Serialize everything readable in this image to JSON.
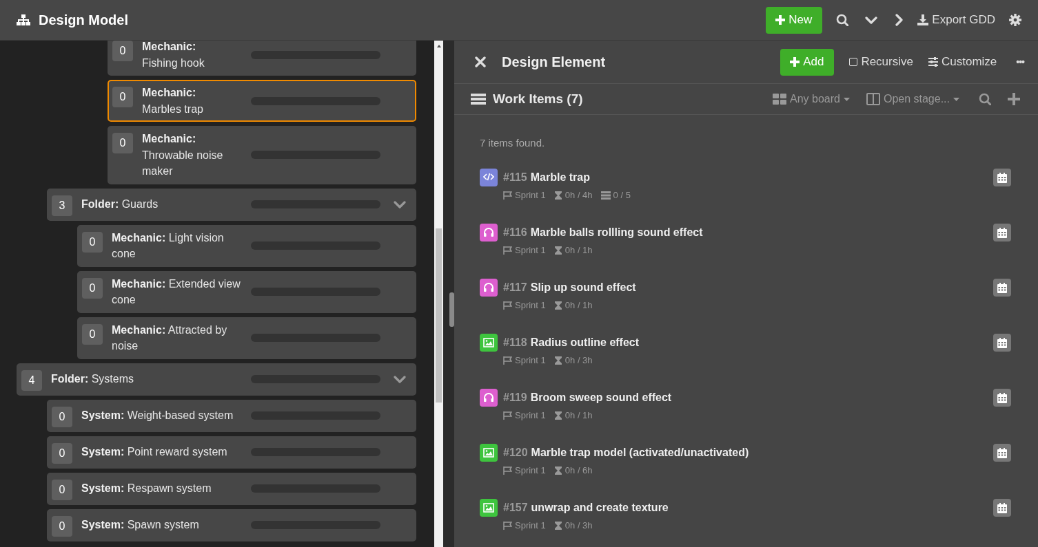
{
  "header": {
    "title": "Design Model",
    "new_button": "New",
    "export_button": "Export GDD"
  },
  "tree": [
    {
      "children": [
        {
          "children": [
            {
              "children": [
                {
                  "kind": "element",
                  "count": "0",
                  "label": "**Mechanic:**\nFishing hook",
                  "selected": false,
                  "level": 0
                },
                {
                  "kind": "element",
                  "count": "0",
                  "label": "**Mechanic:**\nMarbles trap",
                  "selected": true,
                  "level": 0
                },
                {
                  "kind": "element",
                  "count": "0",
                  "label": "**Mechanic:**\nThrowable noise maker",
                  "selected": false,
                  "level": 0
                }
              ]
            }
          ]
        },
        {
          "kind": "folder",
          "count": "3",
          "label": "**Folder:** Guards",
          "selected": false,
          "expanded": true,
          "level": 0,
          "children": [
            {
              "kind": "element",
              "count": "0",
              "label": "**Mechanic:** Light vision cone",
              "selected": false,
              "level": 0
            },
            {
              "kind": "element",
              "count": "0",
              "label": "**Mechanic:** Extended view cone",
              "selected": false,
              "level": 0
            },
            {
              "kind": "element",
              "count": "0",
              "label": "**Mechanic:** Attracted by noise",
              "selected": false,
              "level": 0
            }
          ]
        }
      ]
    },
    {
      "kind": "folder",
      "count": "4",
      "label": "**Folder:** Systems",
      "selected": false,
      "expanded": true,
      "level": 0,
      "children": [
        {
          "kind": "element",
          "count": "0",
          "label": "**System:** Weight-based system",
          "selected": false,
          "level": 0
        },
        {
          "kind": "element",
          "count": "0",
          "label": "**System:** Point reward system",
          "selected": false,
          "level": 0
        },
        {
          "kind": "element",
          "count": "0",
          "label": "**System:** Respawn system",
          "selected": false,
          "level": 0
        },
        {
          "kind": "element",
          "count": "0",
          "label": "**System:** Spawn system",
          "selected": false,
          "level": 0
        }
      ]
    }
  ],
  "panel": {
    "title": "Design Element",
    "add_button": "Add",
    "recursive": {
      "label": "Recursive",
      "checked": false
    },
    "customize_button": "Customize",
    "more_button": "•••"
  },
  "work_items": {
    "title": "Work Items (7)",
    "board_filter": "Any board",
    "stage_filter": "Open stage...",
    "found_text": "7 items found.",
    "items": [
      {
        "kind": "code",
        "color": "#7b84d9",
        "number": "#115",
        "title": "Marble trap",
        "sprint": "Sprint 1",
        "time": "0h / 4h",
        "tasks": "0 / 5"
      },
      {
        "kind": "audio",
        "color": "#dd5fcf",
        "number": "#116",
        "title": "Marble balls rollling sound effect",
        "sprint": "Sprint 1",
        "time": "0h / 1h"
      },
      {
        "kind": "audio",
        "color": "#dd5fcf",
        "number": "#117",
        "title": "Slip up sound effect",
        "sprint": "Sprint 1",
        "time": "0h / 1h"
      },
      {
        "kind": "image",
        "color": "#3ec43e",
        "number": "#118",
        "title": "Radius outline effect",
        "sprint": "Sprint 1",
        "time": "0h / 3h"
      },
      {
        "kind": "audio",
        "color": "#dd5fcf",
        "number": "#119",
        "title": "Broom sweep sound effect",
        "sprint": "Sprint 1",
        "time": "0h / 1h"
      },
      {
        "kind": "image",
        "color": "#3ec43e",
        "number": "#120",
        "title": "Marble trap model (activated/unactivated)",
        "sprint": "Sprint 1",
        "time": "0h / 6h"
      },
      {
        "kind": "image",
        "color": "#3ec43e",
        "number": "#157",
        "title": "unwrap and create texture",
        "sprint": "Sprint 1",
        "time": "0h / 3h"
      }
    ]
  }
}
